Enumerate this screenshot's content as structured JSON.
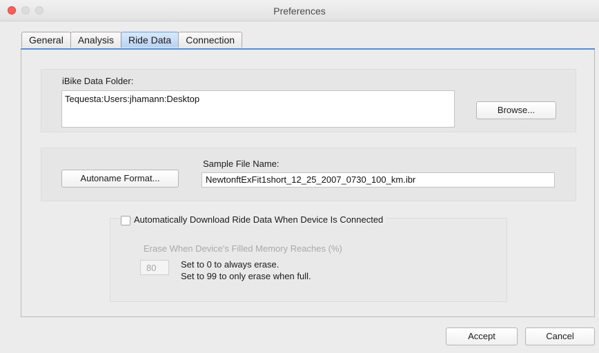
{
  "window": {
    "title": "Preferences"
  },
  "tabs": [
    {
      "label": "General"
    },
    {
      "label": "Analysis"
    },
    {
      "label": "Ride Data",
      "active": true
    },
    {
      "label": "Connection"
    }
  ],
  "data_folder": {
    "label": "iBike Data Folder:",
    "path": "Tequesta:Users:jhamann:Desktop",
    "browse_label": "Browse..."
  },
  "file_name": {
    "autoname_label": "Autoname Format...",
    "sample_label": "Sample File Name:",
    "sample_value": "NewtonftExFit1short_12_25_2007_0730_100_km.ibr"
  },
  "auto_download": {
    "checkbox_label": "Automatically Download Ride Data When Device Is Connected",
    "checked": false,
    "erase_label": "Erase When Device's Filled Memory Reaches (%)",
    "erase_value": "80",
    "help_line1": "Set to 0 to always erase.",
    "help_line2": "Set to 99 to only erase when full."
  },
  "footer": {
    "accept_label": "Accept",
    "cancel_label": "Cancel"
  },
  "colors": {
    "accent": "#4f8edc",
    "close": "#fc5f57"
  }
}
